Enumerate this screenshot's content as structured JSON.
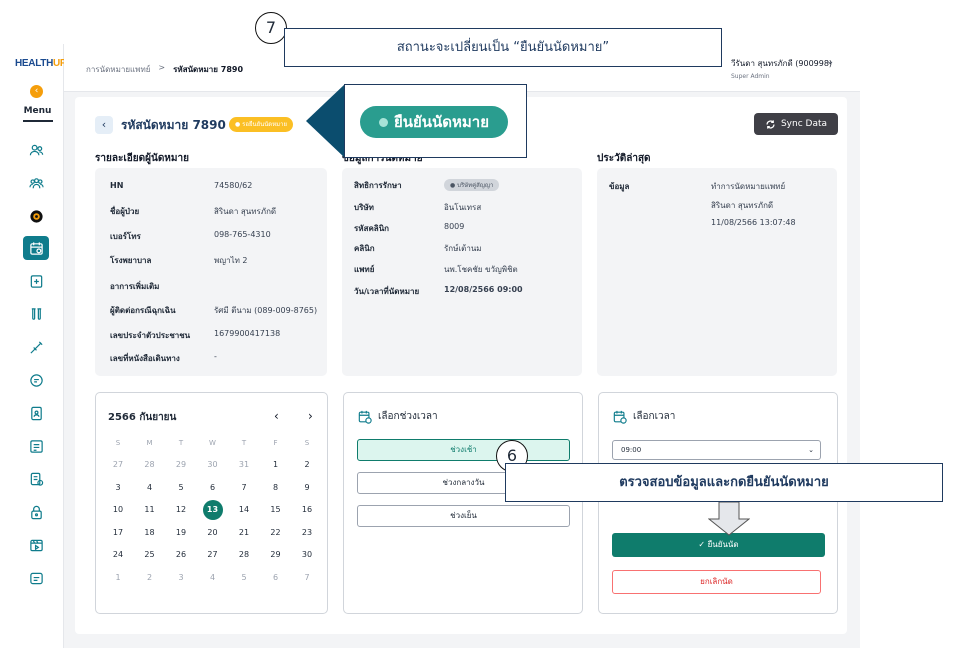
{
  "annotations": {
    "top_step": "7",
    "top_text": "สถานะจะเปลี่ยนเป็น “ยืนยันนัดหมาย”",
    "badge_preview": "ยืนยันนัดหมาย",
    "mid_step": "6",
    "mid_text": "ตรวจสอบข้อมูลและกดยืนยันนัดหมาย"
  },
  "sidebar": {
    "logo_main": "HEALTH",
    "logo_accent": "UP",
    "menu_label": "Menu",
    "collapse_icon": "‹"
  },
  "header": {
    "breadcrumb_parent": "การนัดหมายแพทย์",
    "breadcrumb_sep": ">",
    "breadcrumb_current": "รหัสนัดหมาย 7890",
    "user_name": "วีรันดา สุนทรภักดี (900998)",
    "user_role": "Super Admin"
  },
  "page": {
    "back_icon": "‹",
    "title": "รหัสนัดหมาย  7890",
    "status_badge": "● รอยืนยันนัดหมาย",
    "sync_label": "Sync Data"
  },
  "patient": {
    "section_title": "รายละเอียดผู้นัดหมาย",
    "rows": [
      {
        "label": "HN",
        "value": "74580/62"
      },
      {
        "label": "ชื่อผู้ป่วย",
        "value": "สิรินดา สุนทรภักดี"
      },
      {
        "label": "เบอร์โทร",
        "value": "098-765-4310"
      },
      {
        "label": "โรงพยาบาล",
        "value": "พญาไท 2"
      },
      {
        "label": "อาการเพิ่มเติม",
        "value": ""
      },
      {
        "label": "ผู้ติดต่อกรณีฉุกเฉิน",
        "value": "รัศมี ตีนาม (089-009-8765)"
      },
      {
        "label": "เลขประจำตัวประชาชน",
        "value": "1679900417138"
      },
      {
        "label": "เลขที่หนังสือเดินทาง",
        "value": "-"
      }
    ]
  },
  "appointment": {
    "section_title": "ข้อมูลการนัดหมาย",
    "rows": [
      {
        "label": "สิทธิการรักษา",
        "value": "● บริษัทคู่สัญญา"
      },
      {
        "label": "บริษัท",
        "value": "อินโนเทรส"
      },
      {
        "label": "รหัสคลินิก",
        "value": "8009"
      },
      {
        "label": "คลินิก",
        "value": "รักษ์เต้านม"
      },
      {
        "label": "แพทย์",
        "value": "นพ.โชคชัย ขวัญพิชิต"
      },
      {
        "label": "วัน/เวลาที่นัดหมาย",
        "value": "12/08/2566  09:00"
      }
    ]
  },
  "history": {
    "section_title": "ประวัติล่าสุด",
    "label": "ข้อมูล",
    "lines": [
      "ทำการนัดหมายแพทย์",
      "สิรินดา สุนทรภักดี",
      "11/08/2566 13:07:48"
    ]
  },
  "calendar": {
    "title": "2566  กันยายน",
    "prev_icon": "‹",
    "next_icon": "›",
    "weekdays": [
      "S",
      "M",
      "T",
      "W",
      "T",
      "F",
      "S"
    ],
    "weeks": [
      [
        "27",
        "28",
        "29",
        "30",
        "31",
        "1",
        "2"
      ],
      [
        "3",
        "4",
        "5",
        "6",
        "7",
        "8",
        "9"
      ],
      [
        "10",
        "11",
        "12",
        "13",
        "14",
        "15",
        "16"
      ],
      [
        "17",
        "18",
        "19",
        "20",
        "21",
        "22",
        "23"
      ],
      [
        "24",
        "25",
        "26",
        "27",
        "28",
        "29",
        "30"
      ],
      [
        "1",
        "2",
        "3",
        "4",
        "5",
        "6",
        "7"
      ]
    ],
    "selected": "13"
  },
  "timeslots": {
    "title": "เลือกช่วงเวลา",
    "options": [
      "ช่วงเช้า",
      "ช่วงกลางวัน",
      "ช่วงเย็น"
    ],
    "active": "ช่วงเช้า"
  },
  "time_select": {
    "title": "เลือกเวลา",
    "value": "09:00",
    "confirm_label": "✓  ยืนยันนัด",
    "cancel_label": "ยกเลิกนัด"
  }
}
